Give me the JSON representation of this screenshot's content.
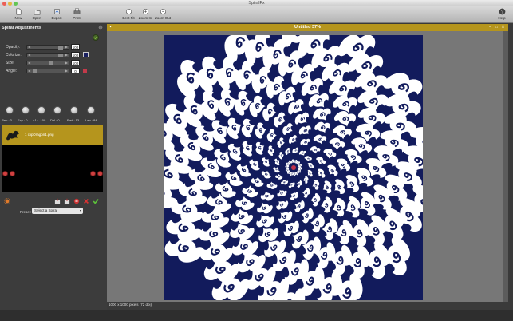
{
  "window": {
    "title": "SpiralFx"
  },
  "toolbar": {
    "new_label": "New",
    "open_label": "Open",
    "export_label": "Export",
    "print_label": "Print",
    "bestfit_label": "Best Fit",
    "zoomin_label": "Zoom In",
    "zoomout_label": "Zoom Out",
    "help_label": "Help"
  },
  "panel": {
    "title": "Spiral Adjustments",
    "sliders": [
      {
        "label": "Opacity:",
        "value": "100",
        "level": 1.0
      },
      {
        "label": "Colorize:",
        "value": "100",
        "level": 1.0
      },
      {
        "label": "Size:",
        "value": "100",
        "level": 0.62
      },
      {
        "label": "Angle:",
        "value": "0",
        "level": 0.0
      }
    ],
    "colorize_color": "#1a2060",
    "angle_color": "#c23a4a",
    "knobs": [
      {
        "label": "Rep.: 3"
      },
      {
        "label": "Exp.: 0"
      },
      {
        "label": "A1.: -100"
      },
      {
        "label": "Del.: 0"
      },
      {
        "label": "Rad.: 13"
      },
      {
        "label": "Len.: 84"
      }
    ],
    "layer": {
      "name": "1 clipDragon1.png"
    },
    "preset_label": "Preset:",
    "preset_value": "Select a Spiral"
  },
  "canvas": {
    "title": "Untitled 37%",
    "status": "1000 x 1000 pixels (72 dpi)",
    "bg_color": "#121b5c",
    "accent": "#b5951d"
  }
}
